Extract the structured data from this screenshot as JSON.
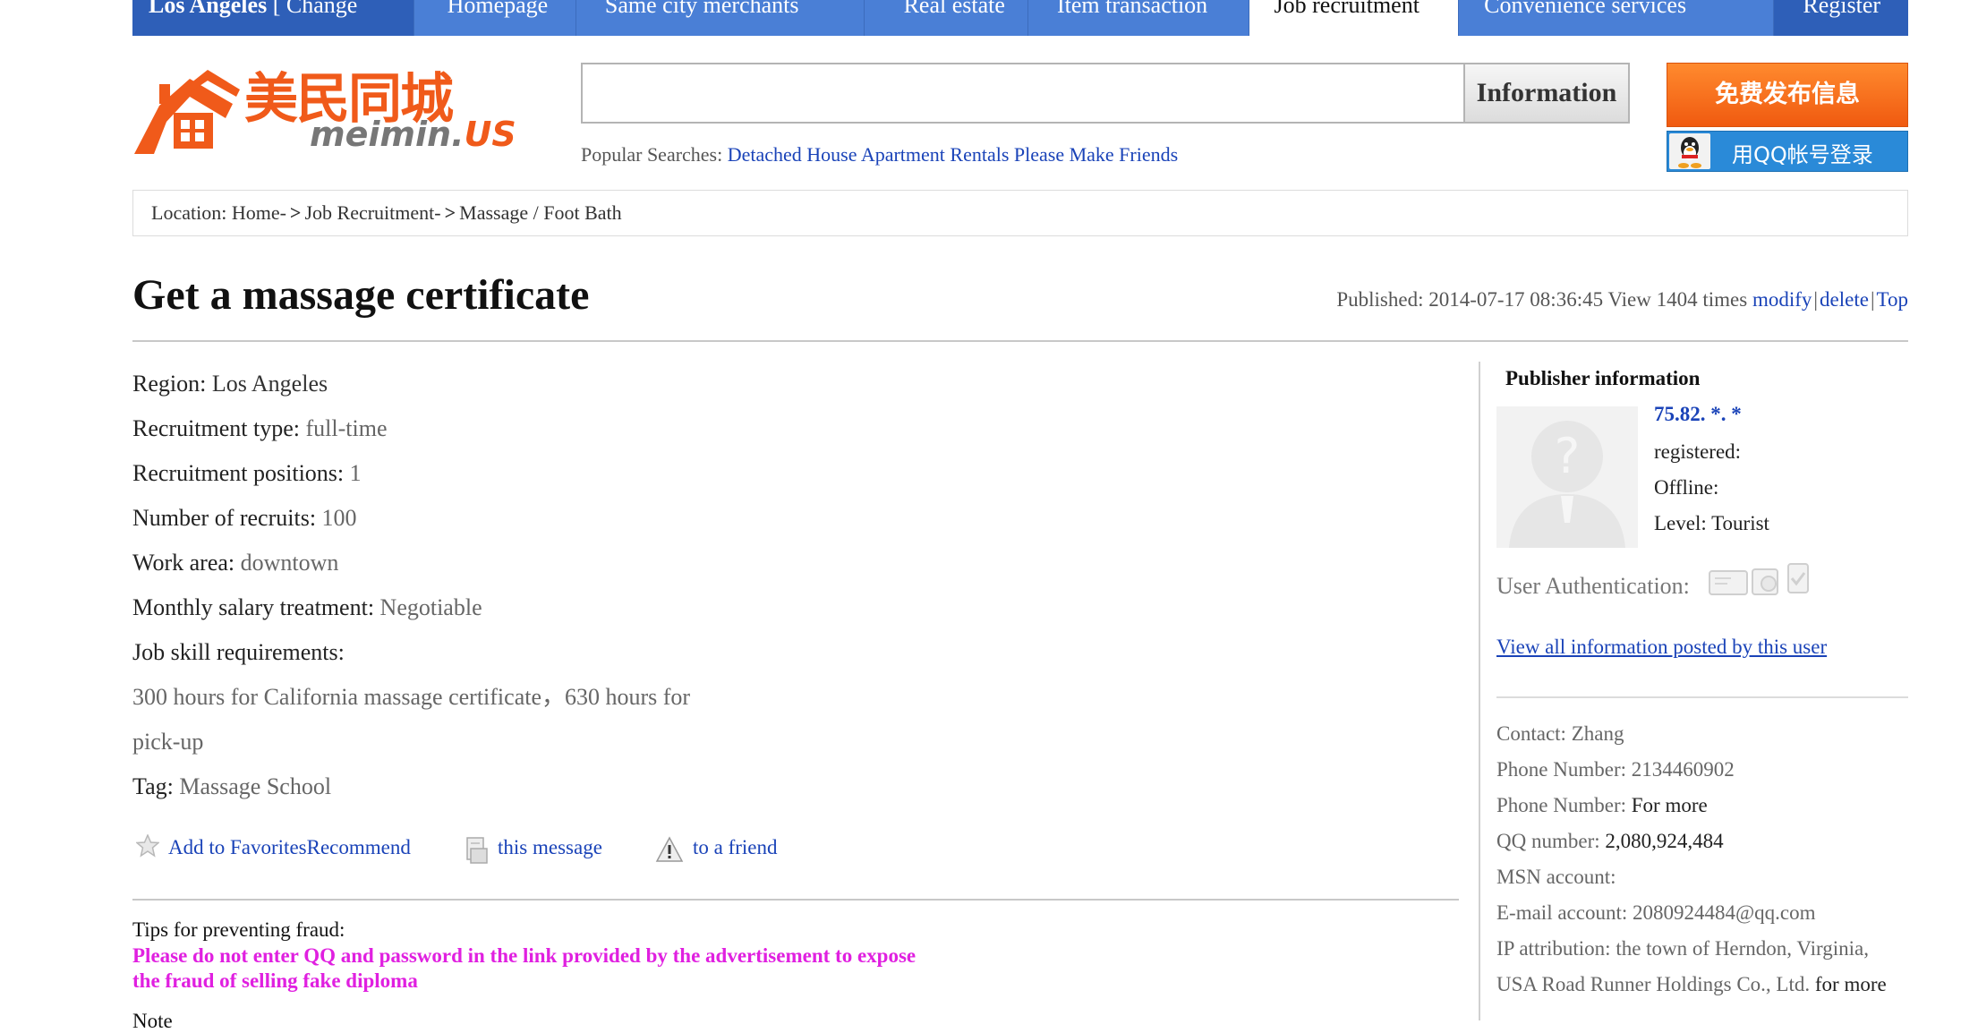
{
  "topnav": {
    "city": "Los Angeles",
    "change": "[ Change",
    "items": [
      "Homepage",
      "Same city merchants",
      "Real estate",
      "Item transaction",
      "Job recruitment",
      "Convenience services"
    ],
    "register": "Register"
  },
  "logo": {
    "cn": "美民同城",
    "en_prefix": "meimin.",
    "en_suffix": "US"
  },
  "search": {
    "value": "",
    "button": "Information"
  },
  "popular": {
    "label": "Popular Searches:",
    "links": [
      "Detached House",
      "Apartment Rentals",
      "Please Make Friends"
    ]
  },
  "header_buttons": {
    "publish": "免费发布信息",
    "qq_login": "用QQ帐号登录"
  },
  "breadcrumb": {
    "label": "Location:",
    "items": [
      "Home-",
      "Job Recruitment-",
      "Massage / Foot Bath"
    ],
    "separator": ">"
  },
  "post": {
    "title": "Get a massage certificate",
    "published_label": "Published:",
    "published": "2014-07-17 08:36:45",
    "views": "View 1404 times",
    "modify": "modify",
    "delete": "delete",
    "top": "Top"
  },
  "details": [
    {
      "label": "Region:",
      "value": "Los Angeles"
    },
    {
      "label": "Recruitment type:",
      "value": "full-time"
    },
    {
      "label": "Recruitment positions:",
      "value": "1"
    },
    {
      "label": "Number of recruits:",
      "value": "100"
    },
    {
      "label": "Work area:",
      "value": "downtown"
    },
    {
      "label": "Monthly salary treatment:",
      "value": "Negotiable"
    }
  ],
  "skills": {
    "label": "Job skill requirements:",
    "line1": "300 hours for California massage certificate，630 hours for",
    "line2": "pick-up"
  },
  "tag": {
    "label": "Tag:",
    "value": "Massage School"
  },
  "actions": {
    "favorites": "Add to FavoritesRecommend",
    "message": "this message",
    "friend": "to a friend"
  },
  "tips": {
    "title": "Tips for preventing fraud:",
    "text": "Please do not enter QQ and password in the link provided by the advertisement to expose the fraud of selling fake diploma",
    "note_peek": "Note"
  },
  "publisher": {
    "title": "Publisher information",
    "ip": "75.82. *. *",
    "registered": "registered:",
    "offline": "Offline:",
    "level_label": "Level:",
    "level": "Tourist",
    "auth_label": "User Authentication:",
    "view_all": "View all information posted by this user"
  },
  "contact": [
    {
      "label": "Contact:",
      "value": "Zhang"
    },
    {
      "label": "Phone Number:",
      "value": "2134460902"
    },
    {
      "label": "Phone Number:",
      "value": "For more"
    },
    {
      "label": "QQ number:",
      "value": "2,080,924,484"
    },
    {
      "label": "MSN account:",
      "value": ""
    },
    {
      "label": "E-mail account:",
      "value": "2080924484@qq.com"
    },
    {
      "label": "IP attribution:",
      "value": "the town of Herndon, Virginia,"
    },
    {
      "label": "",
      "value": "USA Road Runner Holdings Co., Ltd.",
      "extra": "for more"
    }
  ],
  "colors": {
    "nav": "#4a7fd6",
    "nav_dark": "#2e5fb8",
    "link": "#1a43b8",
    "brand_orange": "#f05a1a",
    "warning": "#e020e0"
  }
}
